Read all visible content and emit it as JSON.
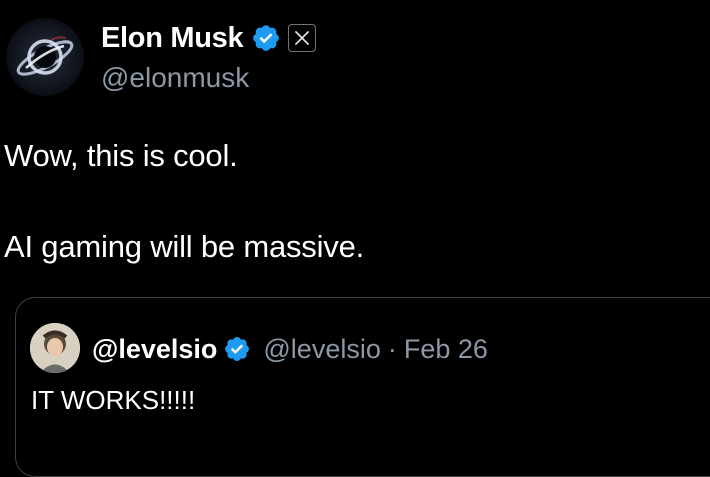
{
  "author": {
    "display_name": "Elon Musk",
    "handle": "@elonmusk",
    "verified": true,
    "affiliate_badge": "X"
  },
  "tweet": {
    "lines": [
      "Wow, this is cool.",
      "AI gaming will be massive."
    ]
  },
  "quoted_tweet": {
    "display_name": "@levelsio",
    "handle": "@levelsio",
    "separator": "·",
    "date": "Feb 26",
    "verified": true,
    "text": "IT WORKS!!!!!"
  },
  "colors": {
    "background": "#000000",
    "verified_blue": "#1d9bf0",
    "secondary_text": "#8b98a5",
    "primary_text": "#ffffff",
    "card_border": "#3e4144"
  }
}
